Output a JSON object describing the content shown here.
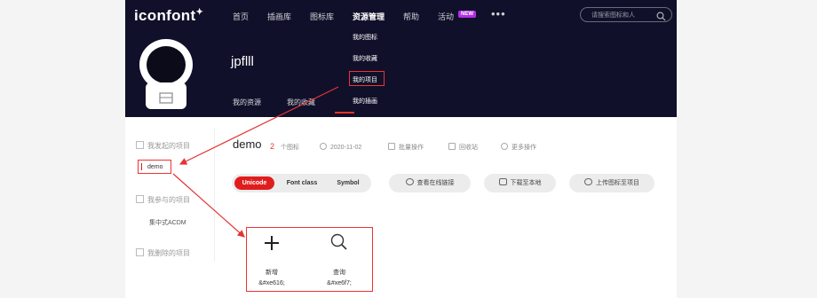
{
  "header": {
    "logo": "iconfont",
    "nav": [
      "首页",
      "插画库",
      "图标库",
      "资源管理",
      "帮助",
      "活动"
    ],
    "new_badge": "NEW",
    "more": "•••",
    "search_placeholder": "请搜索图标和人"
  },
  "dropdown": {
    "items": [
      "我的图标",
      "我的收藏",
      "我的项目",
      "我的插画"
    ]
  },
  "profile": {
    "username": "jpflll",
    "tabs": [
      "我的资源",
      "我的收藏"
    ]
  },
  "sidebar": {
    "sections": [
      {
        "title": "我发起的项目",
        "items": [
          "demo"
        ]
      },
      {
        "title": "我参与的项目",
        "items": [
          "集中式ACDM"
        ]
      },
      {
        "title": "我删除的项目",
        "items": []
      }
    ]
  },
  "project": {
    "name": "demo",
    "count": "2",
    "count_label": "个图标",
    "date": "2020-11-02",
    "actions": [
      "批量操作",
      "回收站",
      "更多操作"
    ]
  },
  "toolbar": {
    "tabs": [
      "Unicode",
      "Font class",
      "Symbol"
    ],
    "buttons": [
      "查看在线链接",
      "下载至本地",
      "上传图标至项目"
    ]
  },
  "icons": [
    {
      "name": "新增",
      "code": "&#xe616;",
      "icon": "plus-icon"
    },
    {
      "name": "查询",
      "code": "&#xe6f7;",
      "icon": "search-icon"
    }
  ],
  "colors": {
    "accent": "#e01d1d",
    "header_bg": "#10102a",
    "annotation": "#e33333"
  }
}
